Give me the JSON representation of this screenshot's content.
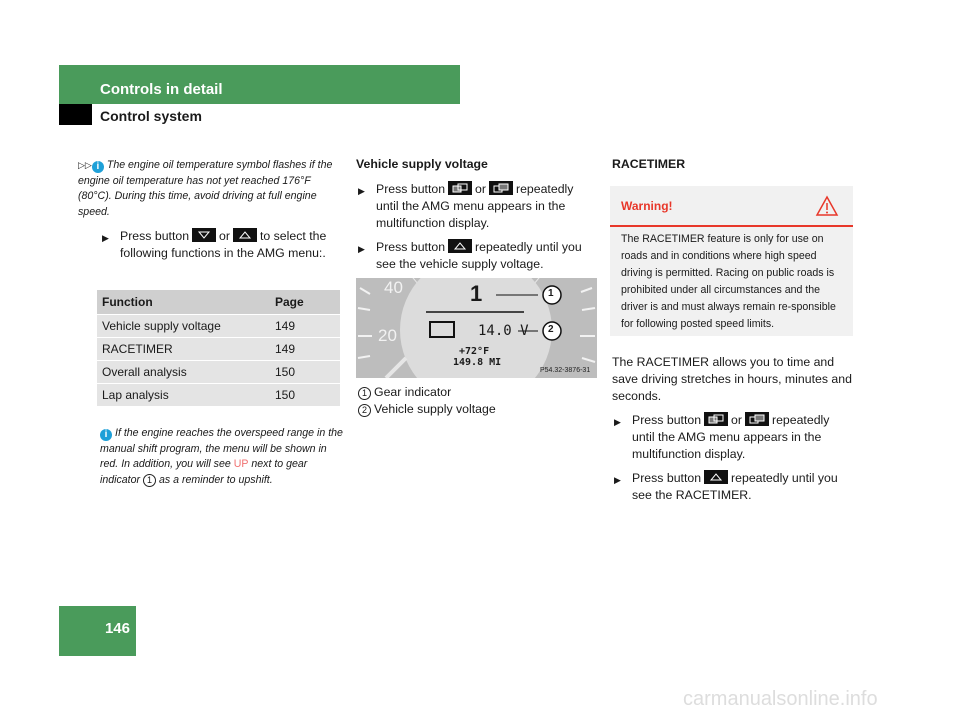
{
  "header": {
    "section": "Controls in detail",
    "subsection": "Control system",
    "page_number": "146"
  },
  "left": {
    "continued_marker": "▷▷",
    "note1": "The engine oil temperature symbol flashes if the engine oil temperature has not yet reached 176°F (80°C). During this time, avoid driving at full engine speed.",
    "step1": {
      "a": "Press button",
      "or": "or",
      "b": "to select the following functions in the AMG menu:."
    },
    "table": {
      "headers": [
        "Function",
        "Page"
      ],
      "rows": [
        [
          "Vehicle supply voltage",
          "149"
        ],
        [
          "RACETIMER",
          "149"
        ],
        [
          "Overall analysis",
          "150"
        ],
        [
          "Lap analysis",
          "150"
        ]
      ]
    },
    "note2": {
      "a": "If the engine reaches the overspeed range in the manual shift program, the menu will be shown in red. In addition, you will see",
      "up": "UP",
      "b": "next to gear indicator",
      "num": "1",
      "c": "as a reminder to upshift."
    }
  },
  "middle": {
    "heading": "Vehicle supply voltage",
    "step1": {
      "a": "Press button",
      "or": "or",
      "b": "repeatedly until the AMG menu appears in the multifunction display."
    },
    "step2": {
      "a": "Press button",
      "b": "repeatedly until you see the vehicle supply voltage."
    },
    "figure": {
      "gear": "1",
      "voltage": "14.0 V",
      "temp": "+72°F",
      "distance": "149.8 MI",
      "code": "P54.32-3876-31",
      "gauge_left": [
        "40",
        "20"
      ],
      "callouts": [
        "1",
        "2"
      ]
    },
    "legend": [
      {
        "num": "1",
        "label": "Gear indicator"
      },
      {
        "num": "2",
        "label": "Vehicle supply voltage"
      }
    ]
  },
  "right": {
    "heading": "RACETIMER",
    "warning": {
      "title": "Warning!",
      "body": "The RACETIMER feature is only for use on roads and in conditions where high speed driving is permitted. Racing on public roads is prohibited under all circumstances and the driver is and must always remain re-sponsible for following posted speed limits."
    },
    "intro": "The RACETIMER allows you to time and save driving stretches in hours, minutes and seconds.",
    "step1": {
      "a": "Press button",
      "or": "or",
      "b": "repeatedly until the AMG menu appears in the multifunction display."
    },
    "step2": {
      "a": "Press button",
      "b": "repeatedly until you see the RACETIMER."
    }
  },
  "watermark": "carmanualsonline.info",
  "colors": {
    "green": "#4a9b5b",
    "warning_red": "#e8372a",
    "info_blue": "#1ea0d8"
  }
}
